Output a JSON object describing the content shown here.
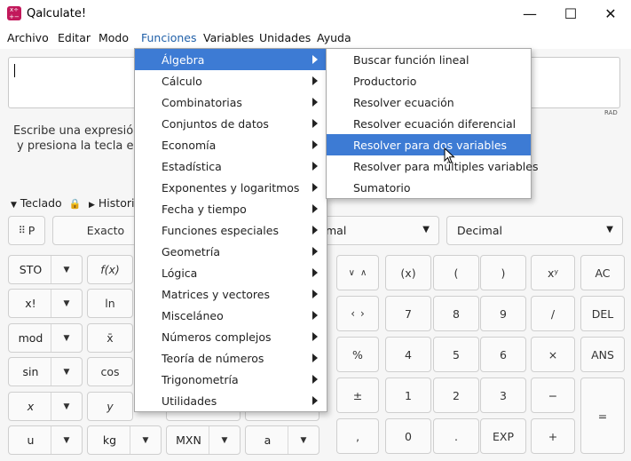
{
  "window": {
    "title": "Qalculate!",
    "app_icon": "calculator-icon"
  },
  "menubar": [
    "Archivo",
    "Editar",
    "Modo",
    "Funciones",
    "Variables",
    "Unidades",
    "Ayuda"
  ],
  "expression": {
    "value": "",
    "angle_unit": "RAD"
  },
  "hint": {
    "line1": "Escribe una expresión",
    "line2": "y presiona la tecla ent"
  },
  "toggles": {
    "keyboard": "Teclado",
    "history": "Historia"
  },
  "toolbar": {
    "keypad": "P",
    "exact": "Exacto",
    "format": "mal",
    "base": "Decimal"
  },
  "keypad_left": {
    "row1": [
      "STO",
      "f(x)"
    ],
    "row2": [
      "x!",
      "ln"
    ],
    "row3": [
      "mod",
      "x̄"
    ],
    "row4": [
      "sin",
      "cos"
    ],
    "row5": [
      "x",
      "y"
    ],
    "row6": [
      "u",
      "kg",
      "MXN",
      "a"
    ]
  },
  "keypad_right": {
    "row1": [
      "(x)",
      "(",
      ")",
      "xʸ",
      "AC"
    ],
    "row2": [
      "7",
      "8",
      "9",
      "/",
      "DEL"
    ],
    "row3": [
      "%",
      "4",
      "5",
      "6",
      "×",
      "ANS"
    ],
    "row4": [
      "±",
      "1",
      "2",
      "3",
      "−",
      "="
    ],
    "row5": [
      "‚",
      "0",
      ".",
      "EXP",
      "+"
    ]
  },
  "funciones_menu": [
    "Álgebra",
    "Cálculo",
    "Combinatorias",
    "Conjuntos de datos",
    "Economía",
    "Estadística",
    "Exponentes y logaritmos",
    "Fecha y tiempo",
    "Funciones especiales",
    "Geometría",
    "Lógica",
    "Matrices y vectores",
    "Misceláneo",
    "Números complejos",
    "Teoría de números",
    "Trigonometría",
    "Utilidades"
  ],
  "algebra_submenu": [
    "Buscar función lineal",
    "Productorio",
    "Resolver ecuación",
    "Resolver ecuación diferencial",
    "Resolver para dos variables",
    "Resolver para múltiples variables",
    "Sumatorio"
  ],
  "colors": {
    "highlight": "#3d7bd4",
    "menu_active_text": "#1f5fa8",
    "app_icon": "#c2185b"
  }
}
